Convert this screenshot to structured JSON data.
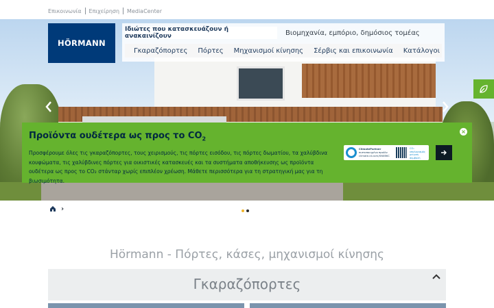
{
  "top_links": [
    "Επικοινωνία",
    "Επιχείρηση",
    "MediaCenter"
  ],
  "logo": {
    "text": "HÖRMANN",
    "color": "#003a79"
  },
  "nav": {
    "tab_active": "Ιδιώτες που κατασκευάζουν ή ανακαινίζουν",
    "tab_other": "Βιομηχανία, εμπόριο, δημόσιος τομέας",
    "menu": [
      "Γκαραζόπορτες",
      "Πόρτες",
      "Μηχανισμοί κίνησης",
      "Σέρβις και επικοινωνία",
      "Κατάλογοι"
    ]
  },
  "hero": {
    "prev_icon": "chevron-left-icon",
    "next_icon": "chevron-right-icon",
    "leaf_icon": "leaf-icon"
  },
  "banner": {
    "title": "Προϊόντα ουδέτερα ως προς το CO",
    "title_sub": "2",
    "text": "Προσφέρουμε όλες τις γκαραζόπορτες, τους χειρισμούς, τις πόρτες εισόδου, τις πόρτες δωματίου, τα χαλύβδινα κουφώματα, τις χαλύβδινες πόρτες για οικιστικές κατασκευές και τα συστήματα αποθήκευσης ως προϊόντα ουδέτερα ως προς το CO₂ στάνταρ χωρίς επιπλέον χρέωση. Μάθετε περισσότερα για τη στρατηγική μας για τη βιωσιμότητα.",
    "badge_title": "ClimatePartner",
    "badge_text": "πιστοποιημένο προϊόν",
    "badge_url": "climate-id.com/XN0BKC",
    "badge_side": "CO₂ υπολογισμός μείωση συμβολή",
    "go_icon": "arrow-right-icon",
    "close_icon": "close-icon",
    "color": "#65b32e"
  },
  "breadcrumb": {
    "home_icon": "home-icon",
    "sep": "›"
  },
  "carousel": {
    "active_index": 0,
    "count": 2
  },
  "main_title": "Hörmann - Πόρτες, κάσες, μηχανισμοί κίνησης",
  "section": {
    "title": "Γκαραζόπορτες",
    "collapse_icon": "chevron-up-icon"
  }
}
